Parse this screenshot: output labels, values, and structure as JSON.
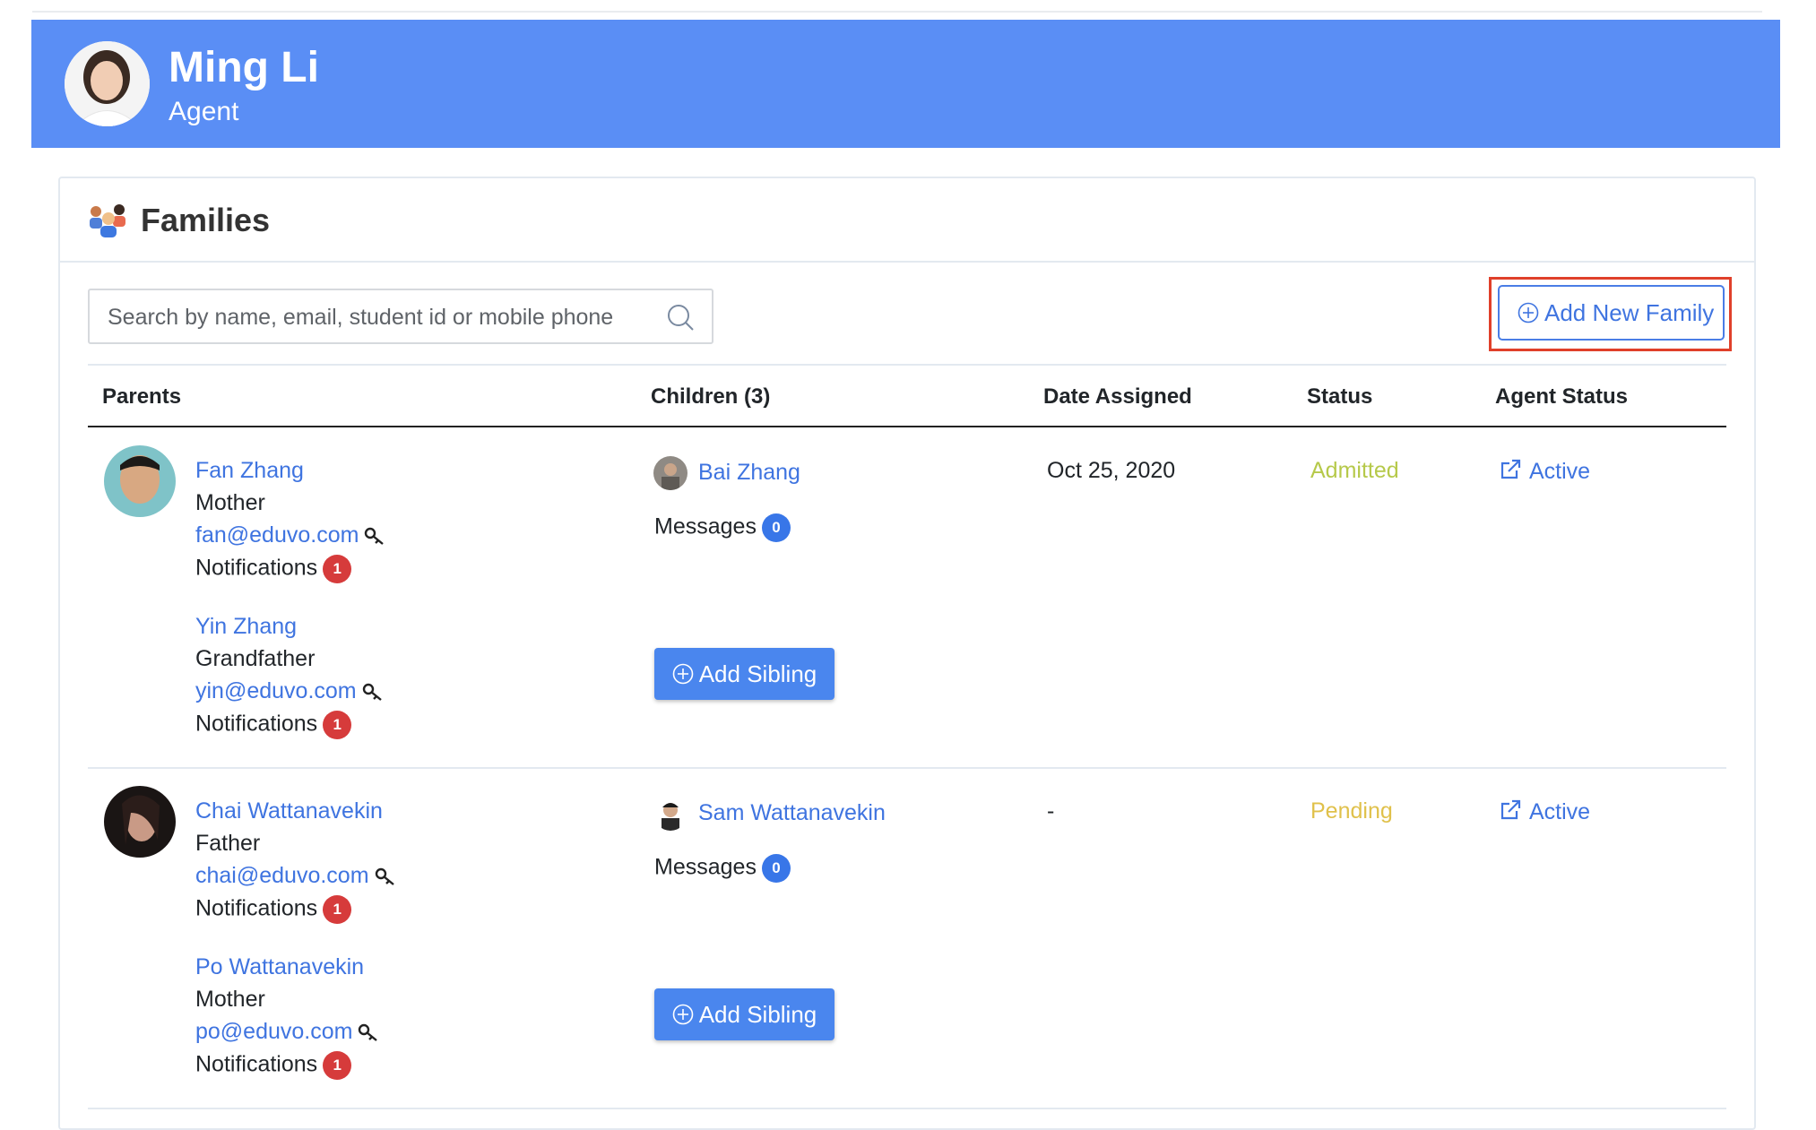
{
  "profile": {
    "name": "Ming Li",
    "role": "Agent"
  },
  "section": {
    "title": "Families",
    "icon": "families-icon"
  },
  "search": {
    "placeholder": "Search by name, email, student id or mobile phone",
    "value": ""
  },
  "actions": {
    "add_family_label": "Add New Family",
    "add_sibling_label": "Add Sibling"
  },
  "table": {
    "headers": {
      "parents": "Parents",
      "children": "Children (3)",
      "date_assigned": "Date Assigned",
      "status": "Status",
      "agent_status": "Agent Status"
    },
    "families": [
      {
        "parents": [
          {
            "name": "Fan Zhang",
            "relation": "Mother",
            "email": "fan@eduvo.com",
            "notifications_label": "Notifications",
            "notifications_count": "1"
          },
          {
            "name": "Yin Zhang",
            "relation": "Grandfather",
            "email": "yin@eduvo.com",
            "notifications_label": "Notifications",
            "notifications_count": "1"
          }
        ],
        "child": {
          "name": "Bai Zhang",
          "messages_label": "Messages",
          "messages_count": "0"
        },
        "date_assigned": "Oct 25, 2020",
        "status": "Admitted",
        "agent_status": "Active"
      },
      {
        "parents": [
          {
            "name": "Chai Wattanavekin",
            "relation": "Father",
            "email": "chai@eduvo.com",
            "notifications_label": "Notifications",
            "notifications_count": "1"
          },
          {
            "name": "Po Wattanavekin",
            "relation": "Mother",
            "email": "po@eduvo.com",
            "notifications_label": "Notifications",
            "notifications_count": "1"
          }
        ],
        "child": {
          "name": "Sam Wattanavekin",
          "messages_label": "Messages",
          "messages_count": "0"
        },
        "date_assigned": "-",
        "status": "Pending",
        "agent_status": "Active"
      }
    ]
  },
  "colors": {
    "banner": "#5a8ef5",
    "link": "#3f74e0",
    "admitted": "#b6c94a",
    "pending": "#e0c14b",
    "badge_red": "#d63b3b",
    "badge_blue": "#3876e8",
    "highlight": "#e0402a"
  }
}
